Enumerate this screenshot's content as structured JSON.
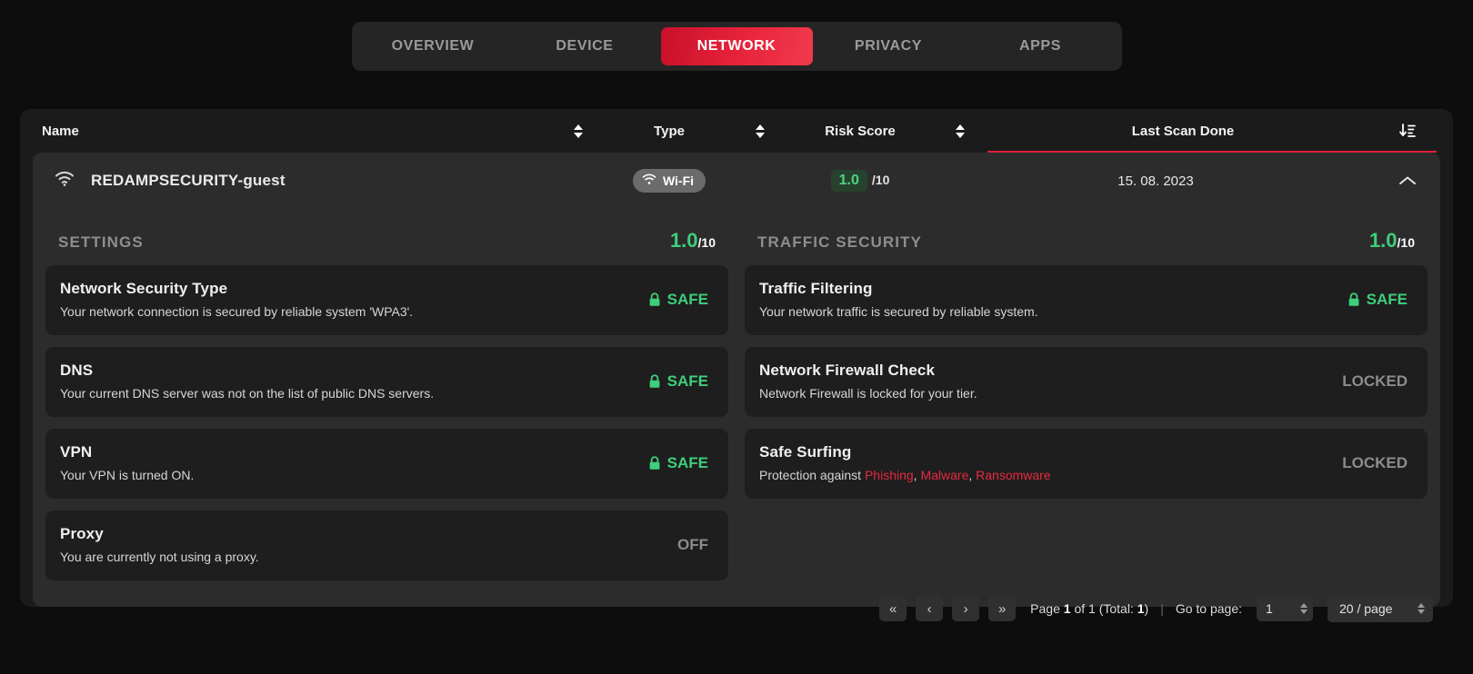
{
  "tabs": [
    {
      "label": "OVERVIEW",
      "active": false
    },
    {
      "label": "DEVICE",
      "active": false
    },
    {
      "label": "NETWORK",
      "active": true
    },
    {
      "label": "PRIVACY",
      "active": false
    },
    {
      "label": "APPS",
      "active": false
    }
  ],
  "table": {
    "columns": {
      "name": "Name",
      "type": "Type",
      "risk_score": "Risk Score",
      "last_scan": "Last Scan Done"
    },
    "sorted_by": "Last Scan Done",
    "sort_direction": "descending",
    "row": {
      "name": "REDAMPSECURITY-guest",
      "type": "Wi-Fi",
      "risk_value": "1.0",
      "risk_denominator": "/10",
      "last_scan": "15. 08. 2023",
      "expanded": true
    }
  },
  "detail": {
    "left": {
      "title": "SETTINGS",
      "score_value": "1.0",
      "score_denominator": "/10",
      "cards": [
        {
          "title": "Network Security Type",
          "subtitle": "Your network connection is secured by reliable system 'WPA3'.",
          "status": "SAFE",
          "status_kind": "safe"
        },
        {
          "title": "DNS",
          "subtitle": "Your current DNS server was not on the list of public DNS servers.",
          "status": "SAFE",
          "status_kind": "safe"
        },
        {
          "title": "VPN",
          "subtitle": "Your VPN is turned ON.",
          "status": "SAFE",
          "status_kind": "safe"
        },
        {
          "title": "Proxy",
          "subtitle": "You are currently not using a proxy.",
          "status": "OFF",
          "status_kind": "off"
        }
      ]
    },
    "right": {
      "title": "TRAFFIC SECURITY",
      "score_value": "1.0",
      "score_denominator": "/10",
      "cards": [
        {
          "title": "Traffic Filtering",
          "subtitle": "Your network traffic is secured by reliable system.",
          "status": "SAFE",
          "status_kind": "safe"
        },
        {
          "title": "Network Firewall Check",
          "subtitle": "Network Firewall is locked for your tier.",
          "status": "LOCKED",
          "status_kind": "locked"
        },
        {
          "title": "Safe Surfing",
          "subtitle_prefix": "Protection against ",
          "threats": [
            "Phishing",
            "Malware",
            "Ransomware"
          ],
          "status": "LOCKED",
          "status_kind": "locked"
        }
      ]
    }
  },
  "pagination": {
    "first_label": "«",
    "prev_label": "‹",
    "next_label": "›",
    "last_label": "»",
    "page_prefix": "Page ",
    "current_page": "1",
    "of_text": " of 1 (Total: ",
    "total": "1",
    "total_suffix": ")",
    "divider": "|",
    "goto_label": "Go to page:",
    "goto_value": "1",
    "per_page": "20 / page"
  },
  "colors": {
    "accent_red": "#e0203a",
    "safe_green": "#3ecf7b",
    "threat_red": "#e8293f",
    "muted": "#8c8c8c"
  }
}
